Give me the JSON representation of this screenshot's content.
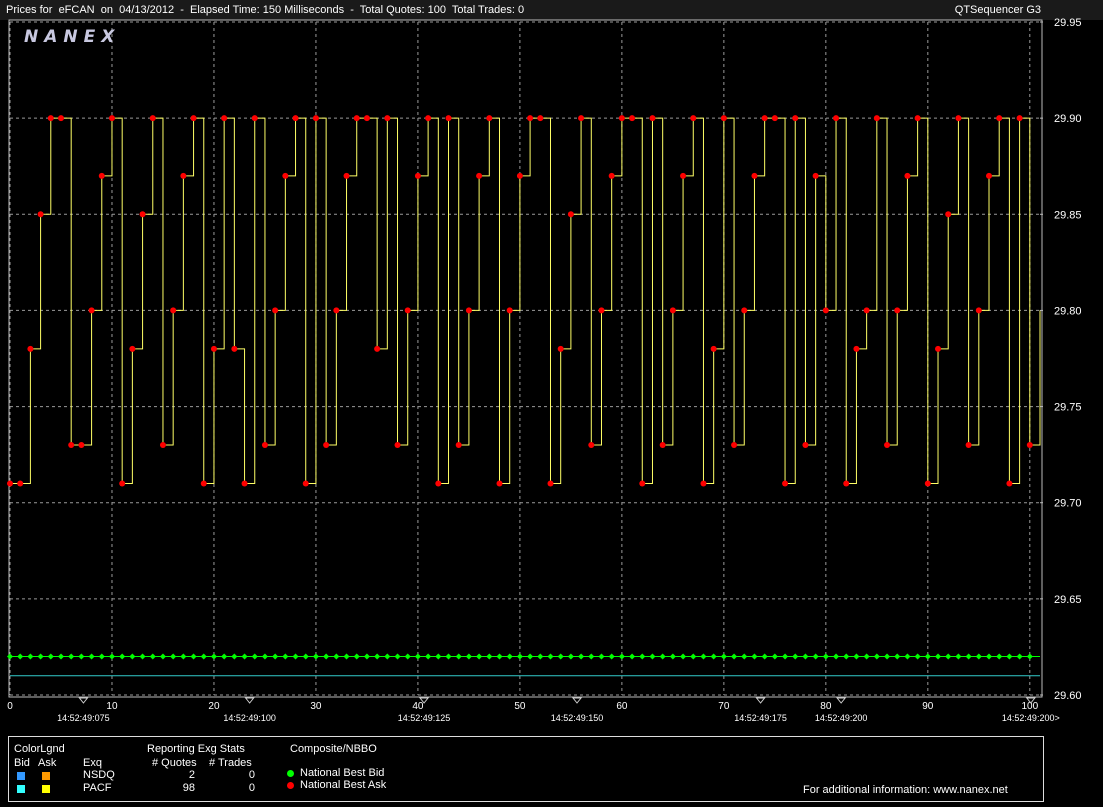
{
  "header": {
    "title": "Prices for  eFCAN  on  04/13/2012  -  Elapsed Time: 150 Milliseconds  -  Total Quotes: 100  Total Trades: 0",
    "app_name": "QTSequencer G3",
    "logo_text": "NANEX"
  },
  "colors": {
    "background": "#000000",
    "plot_border": "#bbbbbb",
    "grid": "#9a9a9a",
    "ask_line": "#ffff66",
    "ask_marker": "#ff0000",
    "bid_marker": "#00ff00",
    "nsdq_bid": "#3399ff",
    "nsdq_ask": "#ff9900",
    "pacf_bid": "#33ffff",
    "pacf_ask": "#ffff00",
    "lower_line": "#33cccc"
  },
  "chart_data": {
    "type": "line",
    "x": [
      0,
      1,
      2,
      3,
      4,
      5,
      6,
      7,
      8,
      9,
      10,
      11,
      12,
      13,
      14,
      15,
      16,
      17,
      18,
      19,
      20,
      21,
      22,
      23,
      24,
      25,
      26,
      27,
      28,
      29,
      30,
      31,
      32,
      33,
      34,
      35,
      36,
      37,
      38,
      39,
      40,
      41,
      42,
      43,
      44,
      45,
      46,
      47,
      48,
      49,
      50,
      51,
      52,
      53,
      54,
      55,
      56,
      57,
      58,
      59,
      60,
      61,
      62,
      63,
      64,
      65,
      66,
      67,
      68,
      69,
      70,
      71,
      72,
      73,
      74,
      75,
      76,
      77,
      78,
      79,
      80,
      81,
      82,
      83,
      84,
      85,
      86,
      87,
      88,
      89,
      90,
      91,
      92,
      93,
      94,
      95,
      96,
      97,
      98,
      99,
      100
    ],
    "series": [
      {
        "name": "National Best Ask",
        "type": "step",
        "values": [
          29.71,
          29.71,
          29.78,
          29.85,
          29.9,
          29.9,
          29.73,
          29.73,
          29.8,
          29.87,
          29.9,
          29.71,
          29.78,
          29.85,
          29.9,
          29.73,
          29.8,
          29.87,
          29.9,
          29.71,
          29.78,
          29.9,
          29.78,
          29.71,
          29.9,
          29.73,
          29.8,
          29.87,
          29.9,
          29.71,
          29.9,
          29.73,
          29.8,
          29.87,
          29.9,
          29.9,
          29.78,
          29.9,
          29.73,
          29.8,
          29.87,
          29.9,
          29.71,
          29.9,
          29.73,
          29.8,
          29.87,
          29.9,
          29.71,
          29.8,
          29.87,
          29.9,
          29.9,
          29.71,
          29.78,
          29.85,
          29.9,
          29.73,
          29.8,
          29.87,
          29.9,
          29.9,
          29.71,
          29.9,
          29.73,
          29.8,
          29.87,
          29.9,
          29.71,
          29.78,
          29.9,
          29.73,
          29.8,
          29.87,
          29.9,
          29.9,
          29.71,
          29.9,
          29.73,
          29.87,
          29.8,
          29.9,
          29.71,
          29.78,
          29.8,
          29.9,
          29.73,
          29.8,
          29.87,
          29.9,
          29.71,
          29.78,
          29.85,
          29.9,
          29.73,
          29.8,
          29.87,
          29.9,
          29.71,
          29.9,
          29.73,
          29.8
        ]
      },
      {
        "name": "National Best Bid",
        "type": "step",
        "constant": 29.62
      }
    ],
    "lower_line_value": 29.61,
    "ylim": [
      29.6,
      29.95
    ],
    "xlim": [
      0,
      101
    ],
    "y_ticks": [
      "29.95",
      "29.90",
      "29.85",
      "29.80",
      "29.75",
      "29.70",
      "29.65",
      "29.60"
    ],
    "x_ticks": [
      "0",
      "10",
      "20",
      "30",
      "40",
      "50",
      "60",
      "70",
      "80",
      "90",
      "100"
    ],
    "time_labels": [
      {
        "at": 7.2,
        "label": "14:52:49:075"
      },
      {
        "at": 23.5,
        "label": "14:52:49:100"
      },
      {
        "at": 40.6,
        "label": "14:52:49:125"
      },
      {
        "at": 55.6,
        "label": "14:52:49:150"
      },
      {
        "at": 73.6,
        "label": "14:52:49:175"
      },
      {
        "at": 81.5,
        "label": "14:52:49:200"
      },
      {
        "at": 100.1,
        "label": "14:52:49:200>"
      }
    ],
    "grid": true
  },
  "legend": {
    "color_legend_title": "ColorLgnd",
    "bid_header": "Bid",
    "ask_header": "Ask",
    "exq_header": "Exq",
    "stats_title": "Reporting Exg Stats",
    "quotes_header": "# Quotes",
    "trades_header": "# Trades",
    "rows": [
      {
        "exch": "NSDQ",
        "quotes": "2",
        "trades": "0"
      },
      {
        "exch": "PACF",
        "quotes": "98",
        "trades": "0"
      }
    ],
    "composite_title": "Composite/NBBO",
    "best_bid_label": "National Best Bid",
    "best_ask_label": "National Best Ask",
    "info_text": "For additional information: www.nanex.net"
  }
}
